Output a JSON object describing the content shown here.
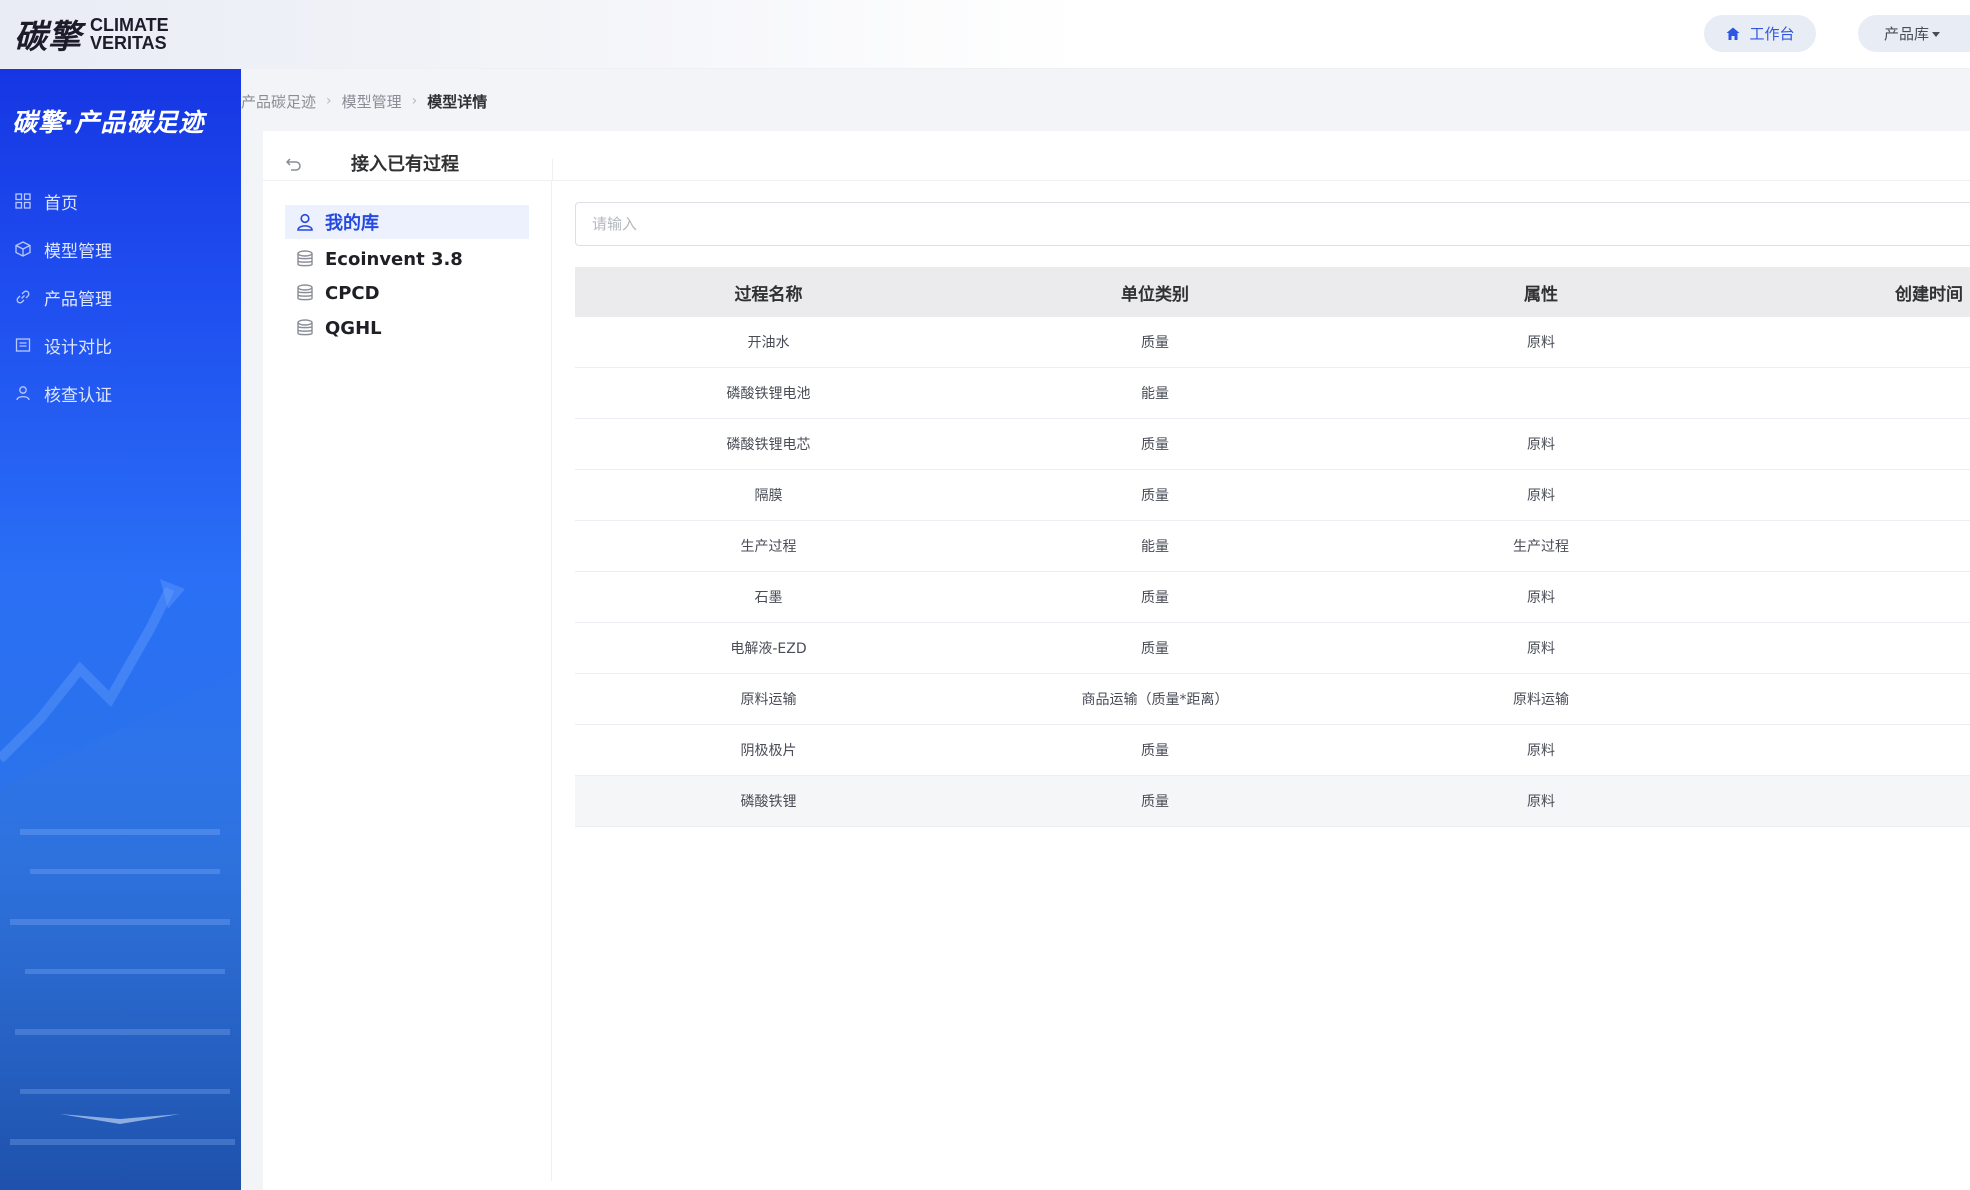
{
  "topbar": {
    "logo_cn": "碳擎",
    "logo_en_line1": "CLIMATE",
    "logo_en_line2": "VERITAS",
    "workbench_label": "工作台",
    "product_lib_label": "产品库"
  },
  "sidebar": {
    "brand": "碳擎·产品碳足迹",
    "items": [
      {
        "label": "首页",
        "icon": "dashboard-icon"
      },
      {
        "label": "模型管理",
        "icon": "cube-icon"
      },
      {
        "label": "产品管理",
        "icon": "link-icon"
      },
      {
        "label": "设计对比",
        "icon": "compare-icon"
      },
      {
        "label": "核查认证",
        "icon": "user-icon"
      }
    ]
  },
  "breadcrumb": {
    "items": [
      "产品碳足迹",
      "模型管理",
      "模型详情"
    ]
  },
  "panel": {
    "title": "接入已有过程",
    "libraries": [
      {
        "label": "我的库",
        "icon": "user-icon",
        "active": true
      },
      {
        "label": "Ecoinvent 3.8",
        "icon": "database-icon",
        "active": false
      },
      {
        "label": "CPCD",
        "icon": "database-icon",
        "active": false
      },
      {
        "label": "QGHL",
        "icon": "database-icon",
        "active": false
      }
    ],
    "search": {
      "placeholder": "请输入",
      "value": ""
    },
    "table": {
      "columns": [
        "过程名称",
        "单位类别",
        "属性",
        "创建时间"
      ],
      "rows": [
        [
          "开油水",
          "质量",
          "原料",
          ""
        ],
        [
          "磷酸铁锂电池",
          "能量",
          "",
          ""
        ],
        [
          "磷酸铁锂电芯",
          "质量",
          "原料",
          ""
        ],
        [
          "隔膜",
          "质量",
          "原料",
          ""
        ],
        [
          "生产过程",
          "能量",
          "生产过程",
          ""
        ],
        [
          "石墨",
          "质量",
          "原料",
          ""
        ],
        [
          "电解液-EZD",
          "质量",
          "原料",
          ""
        ],
        [
          "原料运输",
          "商品运输（质量*距离）",
          "原料运输",
          ""
        ],
        [
          "阴极极片",
          "质量",
          "原料",
          ""
        ],
        [
          "磷酸铁锂",
          "质量",
          "原料",
          ""
        ]
      ]
    }
  },
  "colors": {
    "accent": "#2649e0",
    "sidebar_top": "#1636e3",
    "table_header_bg": "#ebebed"
  }
}
